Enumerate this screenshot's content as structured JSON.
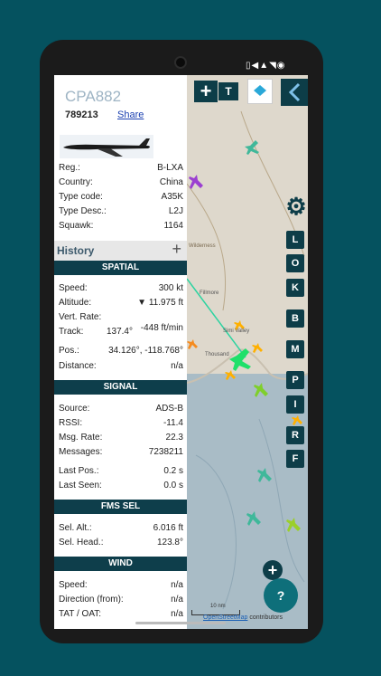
{
  "status": {
    "icons": "▯◀▲◥◉"
  },
  "flight": {
    "callsign": "CPA882",
    "hex": "789213",
    "share_label": "Share"
  },
  "details": [
    {
      "key": "Reg.:",
      "value": "B-LXA"
    },
    {
      "key": "Country:",
      "value": "China"
    },
    {
      "key": "Type code:",
      "value": "A35K"
    },
    {
      "key": "Type Desc.:",
      "value": "L2J"
    },
    {
      "key": "Squawk:",
      "value": "1164"
    }
  ],
  "history": {
    "label": "History",
    "add": "+"
  },
  "spatial": {
    "title": "SPATIAL",
    "rows": [
      {
        "key": "Speed:",
        "value": "300 kt"
      },
      {
        "key": "Altitude:",
        "value": "▼ 11.975 ft"
      },
      {
        "key": "Vert. Rate:",
        "value": "-448 ft/min"
      },
      {
        "key": "Track:",
        "value": "137.4°"
      },
      {
        "key": "Pos.:",
        "value": "34.126°, -118.768°"
      },
      {
        "key": "Distance:",
        "value": "n/a"
      }
    ]
  },
  "signal": {
    "title": "SIGNAL",
    "rows": [
      {
        "key": "Source:",
        "value": "ADS-B"
      },
      {
        "key": "RSSI:",
        "value": "-11.4"
      },
      {
        "key": "Msg. Rate:",
        "value": "22.3"
      },
      {
        "key": "Messages:",
        "value": "7238211"
      },
      {
        "key": "Last Pos.:",
        "value": "0.2 s"
      },
      {
        "key": "Last Seen:",
        "value": "0.0 s"
      }
    ]
  },
  "fms": {
    "title": "FMS SEL",
    "rows": [
      {
        "key": "Sel. Alt.:",
        "value": "6.016 ft"
      },
      {
        "key": "Sel. Head.:",
        "value": "123.8°"
      }
    ]
  },
  "wind": {
    "title": "WIND",
    "rows": [
      {
        "key": "Speed:",
        "value": "n/a"
      },
      {
        "key": "Direction (from):",
        "value": "n/a"
      },
      {
        "key": "TAT / OAT:",
        "value": "n/a"
      }
    ]
  },
  "map": {
    "top_t": "T",
    "side_buttons": [
      "L",
      "O",
      "K",
      "B",
      "M",
      "P",
      "I",
      "R",
      "F"
    ],
    "labels": [
      "Wilderness",
      "Fillmore",
      "Simi Valley",
      "Thousand"
    ],
    "help": "?",
    "scale": "10 nm",
    "attribution_link": "OpenStreetMap",
    "attribution_text": " contributors"
  },
  "colors": {
    "panel_header": "#0e3e4b",
    "background": "#05525f",
    "accent_plane": "#ffb000"
  }
}
